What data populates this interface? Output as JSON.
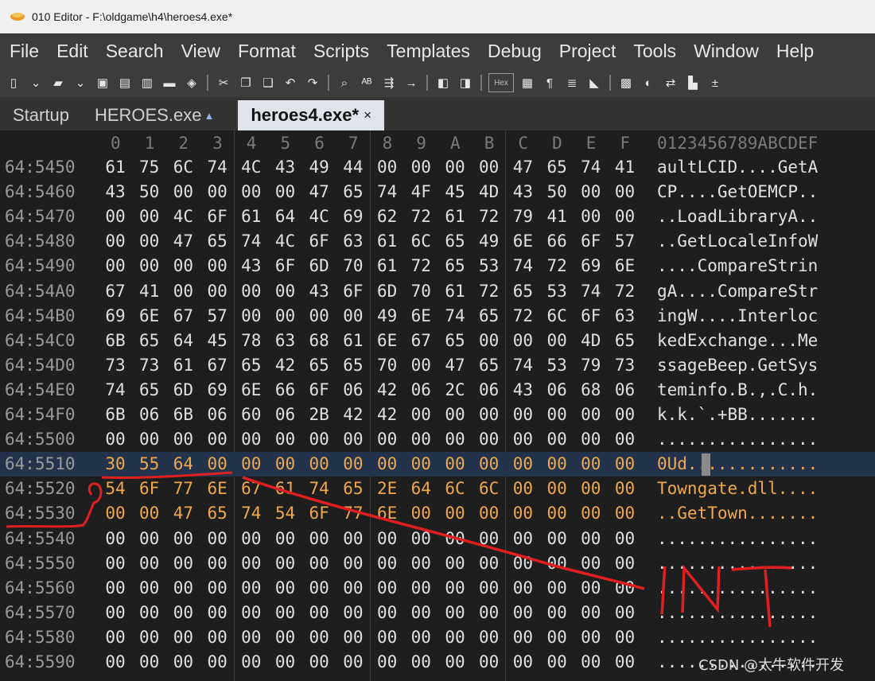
{
  "window": {
    "title": "010 Editor - F:\\oldgame\\h4\\heroes4.exe*"
  },
  "menu": [
    "File",
    "Edit",
    "Search",
    "View",
    "Format",
    "Scripts",
    "Templates",
    "Debug",
    "Project",
    "Tools",
    "Window",
    "Help"
  ],
  "toolbar": {
    "icons": [
      "new-file-icon",
      "dropdown-icon",
      "open-folder-icon",
      "dropdown-icon",
      "save-icon",
      "save-as-icon",
      "save-all-icon",
      "folder-icon",
      "workspace-icon",
      "separator",
      "cut-icon",
      "copy-icon",
      "paste-icon",
      "undo-icon",
      "redo-icon",
      "separator",
      "find-icon",
      "replace-icon",
      "find-in-files-icon",
      "goto-icon",
      "separator",
      "bookmark-icon",
      "bookmark-list-icon",
      "separator",
      "hex-mode-icon",
      "columns-icon",
      "paragraph-icon",
      "text-mode-icon",
      "highlight-icon",
      "separator",
      "calculator-icon",
      "inspector-icon",
      "compare-icon",
      "histogram-icon",
      "checksum-icon"
    ],
    "hex_label": "Hex"
  },
  "tabs": [
    {
      "label": "Startup",
      "active": false
    },
    {
      "label": "HEROES.exe",
      "active": false,
      "locked": true
    },
    {
      "label": "heroes4.exe*",
      "active": true,
      "close": "×"
    }
  ],
  "hex": {
    "columns": [
      "0",
      "1",
      "2",
      "3",
      "4",
      "5",
      "6",
      "7",
      "8",
      "9",
      "A",
      "B",
      "C",
      "D",
      "E",
      "F"
    ],
    "ascii_header": "0123456789ABCDEF",
    "rows": [
      {
        "addr": "64:5450",
        "bytes": [
          "61",
          "75",
          "6C",
          "74",
          "4C",
          "43",
          "49",
          "44",
          "00",
          "00",
          "00",
          "00",
          "47",
          "65",
          "74",
          "41"
        ],
        "ascii": "aultLCID....GetA"
      },
      {
        "addr": "64:5460",
        "bytes": [
          "43",
          "50",
          "00",
          "00",
          "00",
          "00",
          "47",
          "65",
          "74",
          "4F",
          "45",
          "4D",
          "43",
          "50",
          "00",
          "00"
        ],
        "ascii": "CP....GetOEMCP.."
      },
      {
        "addr": "64:5470",
        "bytes": [
          "00",
          "00",
          "4C",
          "6F",
          "61",
          "64",
          "4C",
          "69",
          "62",
          "72",
          "61",
          "72",
          "79",
          "41",
          "00",
          "00"
        ],
        "ascii": "..LoadLibraryA.."
      },
      {
        "addr": "64:5480",
        "bytes": [
          "00",
          "00",
          "47",
          "65",
          "74",
          "4C",
          "6F",
          "63",
          "61",
          "6C",
          "65",
          "49",
          "6E",
          "66",
          "6F",
          "57"
        ],
        "ascii": "..GetLocaleInfoW"
      },
      {
        "addr": "64:5490",
        "bytes": [
          "00",
          "00",
          "00",
          "00",
          "43",
          "6F",
          "6D",
          "70",
          "61",
          "72",
          "65",
          "53",
          "74",
          "72",
          "69",
          "6E"
        ],
        "ascii": "....CompareStrin"
      },
      {
        "addr": "64:54A0",
        "bytes": [
          "67",
          "41",
          "00",
          "00",
          "00",
          "00",
          "43",
          "6F",
          "6D",
          "70",
          "61",
          "72",
          "65",
          "53",
          "74",
          "72"
        ],
        "ascii": "gA....CompareStr"
      },
      {
        "addr": "64:54B0",
        "bytes": [
          "69",
          "6E",
          "67",
          "57",
          "00",
          "00",
          "00",
          "00",
          "49",
          "6E",
          "74",
          "65",
          "72",
          "6C",
          "6F",
          "63"
        ],
        "ascii": "ingW....Interloc"
      },
      {
        "addr": "64:54C0",
        "bytes": [
          "6B",
          "65",
          "64",
          "45",
          "78",
          "63",
          "68",
          "61",
          "6E",
          "67",
          "65",
          "00",
          "00",
          "00",
          "4D",
          "65"
        ],
        "ascii": "kedExchange...Me"
      },
      {
        "addr": "64:54D0",
        "bytes": [
          "73",
          "73",
          "61",
          "67",
          "65",
          "42",
          "65",
          "65",
          "70",
          "00",
          "47",
          "65",
          "74",
          "53",
          "79",
          "73"
        ],
        "ascii": "ssageBeep.GetSys"
      },
      {
        "addr": "64:54E0",
        "bytes": [
          "74",
          "65",
          "6D",
          "69",
          "6E",
          "66",
          "6F",
          "06",
          "42",
          "06",
          "2C",
          "06",
          "43",
          "06",
          "68",
          "06"
        ],
        "ascii": "teminfo.B.,.C.h."
      },
      {
        "addr": "64:54F0",
        "bytes": [
          "6B",
          "06",
          "6B",
          "06",
          "60",
          "06",
          "2B",
          "42",
          "42",
          "00",
          "00",
          "00",
          "00",
          "00",
          "00",
          "00"
        ],
        "ascii": "k.k.`.+BB......."
      },
      {
        "addr": "64:5500",
        "bytes": [
          "00",
          "00",
          "00",
          "00",
          "00",
          "00",
          "00",
          "00",
          "00",
          "00",
          "00",
          "00",
          "00",
          "00",
          "00",
          "00"
        ],
        "ascii": "................"
      },
      {
        "addr": "64:5510",
        "bytes": [
          "30",
          "55",
          "64",
          "00",
          "00",
          "00",
          "00",
          "00",
          "00",
          "00",
          "00",
          "00",
          "00",
          "00",
          "00",
          "00"
        ],
        "ascii": "0Ud............."
      },
      {
        "addr": "64:5520",
        "bytes": [
          "54",
          "6F",
          "77",
          "6E",
          "67",
          "61",
          "74",
          "65",
          "2E",
          "64",
          "6C",
          "6C",
          "00",
          "00",
          "00",
          "00"
        ],
        "ascii": "Towngate.dll...."
      },
      {
        "addr": "64:5530",
        "bytes": [
          "00",
          "00",
          "47",
          "65",
          "74",
          "54",
          "6F",
          "77",
          "6E",
          "00",
          "00",
          "00",
          "00",
          "00",
          "00",
          "00"
        ],
        "ascii": "..GetTown......."
      },
      {
        "addr": "64:5540",
        "bytes": [
          "00",
          "00",
          "00",
          "00",
          "00",
          "00",
          "00",
          "00",
          "00",
          "00",
          "00",
          "00",
          "00",
          "00",
          "00",
          "00"
        ],
        "ascii": "................"
      },
      {
        "addr": "64:5550",
        "bytes": [
          "00",
          "00",
          "00",
          "00",
          "00",
          "00",
          "00",
          "00",
          "00",
          "00",
          "00",
          "00",
          "00",
          "00",
          "00",
          "00"
        ],
        "ascii": "................"
      },
      {
        "addr": "64:5560",
        "bytes": [
          "00",
          "00",
          "00",
          "00",
          "00",
          "00",
          "00",
          "00",
          "00",
          "00",
          "00",
          "00",
          "00",
          "00",
          "00",
          "00"
        ],
        "ascii": "................"
      },
      {
        "addr": "64:5570",
        "bytes": [
          "00",
          "00",
          "00",
          "00",
          "00",
          "00",
          "00",
          "00",
          "00",
          "00",
          "00",
          "00",
          "00",
          "00",
          "00",
          "00"
        ],
        "ascii": "................"
      },
      {
        "addr": "64:5580",
        "bytes": [
          "00",
          "00",
          "00",
          "00",
          "00",
          "00",
          "00",
          "00",
          "00",
          "00",
          "00",
          "00",
          "00",
          "00",
          "00",
          "00"
        ],
        "ascii": "................"
      },
      {
        "addr": "64:5590",
        "bytes": [
          "00",
          "00",
          "00",
          "00",
          "00",
          "00",
          "00",
          "00",
          "00",
          "00",
          "00",
          "00",
          "00",
          "00",
          "00",
          "00"
        ],
        "ascii": "................"
      }
    ]
  },
  "annotation": {
    "text": "INT",
    "color": "#e02020"
  },
  "watermark": "CSDN @太牛软件开发",
  "colors": {
    "highlight_text": "#f0a84c",
    "selection_bg": "#24334c",
    "background": "#1e1e1e"
  }
}
